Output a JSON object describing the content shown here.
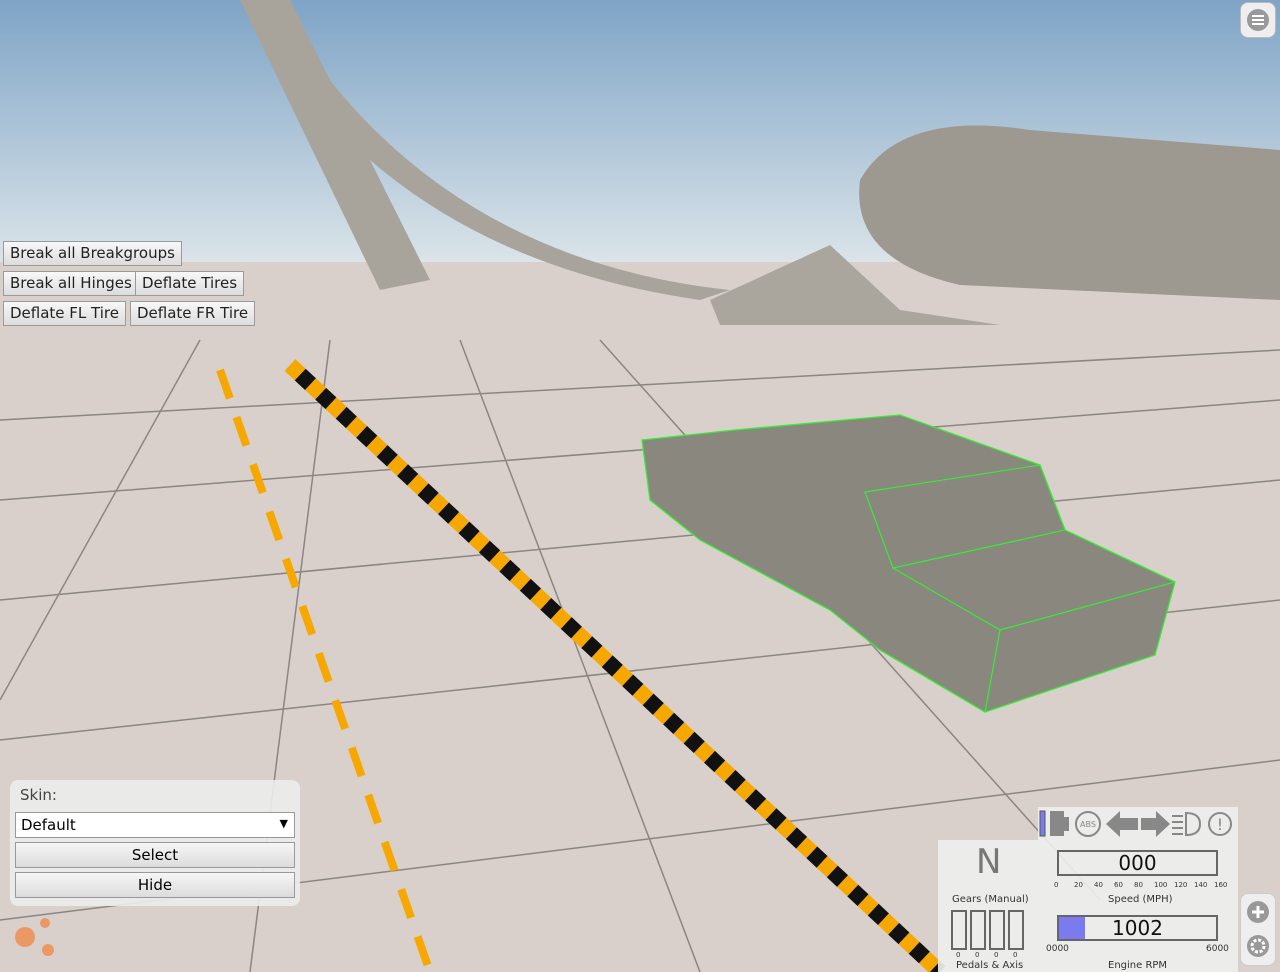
{
  "debug_buttons": [
    "Break all Breakgroups",
    "Break all Hinges",
    "Deflate Tires",
    "Deflate FL Tire",
    "Deflate FR Tire"
  ],
  "skin": {
    "label": "Skin:",
    "selected": "Default",
    "select_label": "Select",
    "hide_label": "Hide"
  },
  "dash": {
    "gear": "N",
    "gear_label": "Gears (Manual)",
    "speed": "000",
    "speed_label": "Speed (MPH)",
    "speed_ticks": [
      "0",
      "20",
      "40",
      "60",
      "80",
      "100",
      "120",
      "140",
      "160"
    ],
    "rpm": "1002",
    "rpm_min": "0000",
    "rpm_max": "6000",
    "rpm_label": "Engine RPM",
    "rpm_fraction": 0.167,
    "pedals_label": "Pedals & Axis",
    "pedal_values": [
      "0",
      "0",
      "0",
      "0"
    ],
    "fuel_fraction": 1.0,
    "rpm_color": "#7b7bef"
  },
  "icons": [
    "fuel-icon",
    "abs-icon",
    "left-signal-icon",
    "right-signal-icon",
    "headlight-icon",
    "brake-warning-icon"
  ]
}
